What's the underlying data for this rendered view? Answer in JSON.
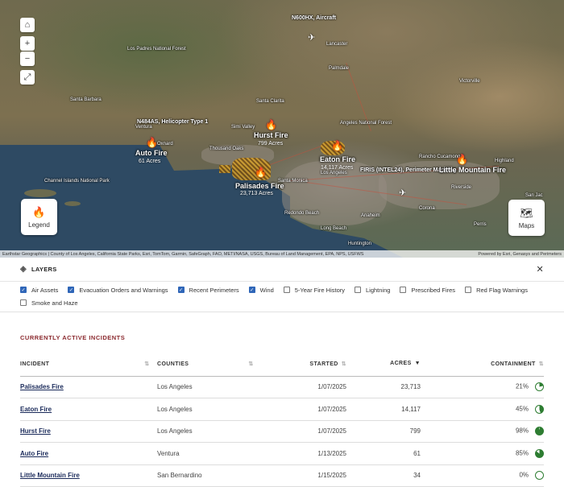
{
  "map": {
    "labels": {
      "los_padres": "Los Padres National Forest",
      "lancaster": "Lancaster",
      "palmdale": "Palmdale",
      "victorville": "Victorville",
      "santa_barbara": "Santa Barbara",
      "santa_clarita": "Santa Clarita",
      "ventura": "Ventura",
      "oxnard": "Oxnard",
      "simi_valley": "Simi Valley",
      "thousand_oaks": "Thousand Oaks",
      "angeles": "Angeles National Forest",
      "rancho": "Rancho Cucamonga",
      "highland": "Highland",
      "santa_monica": "Santa Monica",
      "los_angeles": "Los Angeles",
      "riverside": "Riverside",
      "anaheim": "Anaheim",
      "long_beach": "Long Beach",
      "redondo": "Redondo Beach",
      "corona": "Corona",
      "channel_islands": "Channel Islands National Park",
      "huntington": "Huntington",
      "perris": "Perris",
      "san_jacinto": "San Jac"
    },
    "aircraft": [
      {
        "label": "N600HX, Aircraft"
      },
      {
        "label": "N484AS, Helicopter Type 1"
      },
      {
        "label": "FIRIS (INTEL24), Perimeter Mapping"
      }
    ],
    "fires": [
      {
        "name": "Hurst Fire",
        "acres": "799 Acres"
      },
      {
        "name": "Auto Fire",
        "acres": "61 Acres"
      },
      {
        "name": "Eaton Fire",
        "acres": "14,117 Acres"
      },
      {
        "name": "Palisades Fire",
        "acres": "23,713 Acres"
      },
      {
        "name": "Little Mountain Fire",
        "acres": ""
      }
    ],
    "legend_label": "Legend",
    "maps_label": "Maps",
    "attribution_left": "Earthstar Geographics | County of Los Angeles, California State Parks, Esri, TomTom, Garmin, SafeGraph, FAO, METI/NASA, USGS, Bureau of Land Management, EPA, NPS, USFWS",
    "attribution_right": "Powered by Esri, Genasys and Perimeters"
  },
  "layers": {
    "title": "LAYERS",
    "items": [
      {
        "label": "Air Assets",
        "checked": true
      },
      {
        "label": "Evacuation Orders and Warnings",
        "checked": true
      },
      {
        "label": "Recent Perimeters",
        "checked": true
      },
      {
        "label": "Wind",
        "checked": true
      },
      {
        "label": "5-Year Fire History",
        "checked": false
      },
      {
        "label": "Lightning",
        "checked": false
      },
      {
        "label": "Prescribed Fires",
        "checked": false
      },
      {
        "label": "Red Flag Warnings",
        "checked": false
      },
      {
        "label": "Smoke and Haze",
        "checked": false
      }
    ]
  },
  "incidents": {
    "title": "CURRENTLY ACTIVE INCIDENTS",
    "columns": {
      "incident": "INCIDENT",
      "counties": "COUNTIES",
      "started": "STARTED",
      "acres": "ACRES",
      "containment": "CONTAINMENT"
    },
    "rows": [
      {
        "incident": "Palisades Fire",
        "county": "Los Angeles",
        "started": "1/07/2025",
        "acres": "23,713",
        "containment": "21%",
        "pct": 21
      },
      {
        "incident": "Eaton Fire",
        "county": "Los Angeles",
        "started": "1/07/2025",
        "acres": "14,117",
        "containment": "45%",
        "pct": 45
      },
      {
        "incident": "Hurst Fire",
        "county": "Los Angeles",
        "started": "1/07/2025",
        "acres": "799",
        "containment": "98%",
        "pct": 98
      },
      {
        "incident": "Auto Fire",
        "county": "Ventura",
        "started": "1/13/2025",
        "acres": "61",
        "containment": "85%",
        "pct": 85
      },
      {
        "incident": "Little Mountain Fire",
        "county": "San Bernardino",
        "started": "1/15/2025",
        "acres": "34",
        "containment": "0%",
        "pct": 0
      }
    ]
  },
  "colors": {
    "containment": "#2e7d32",
    "section_title": "#8b2a2f",
    "checkbox_on": "#2f66b8",
    "fire_icon": "#e33333"
  }
}
